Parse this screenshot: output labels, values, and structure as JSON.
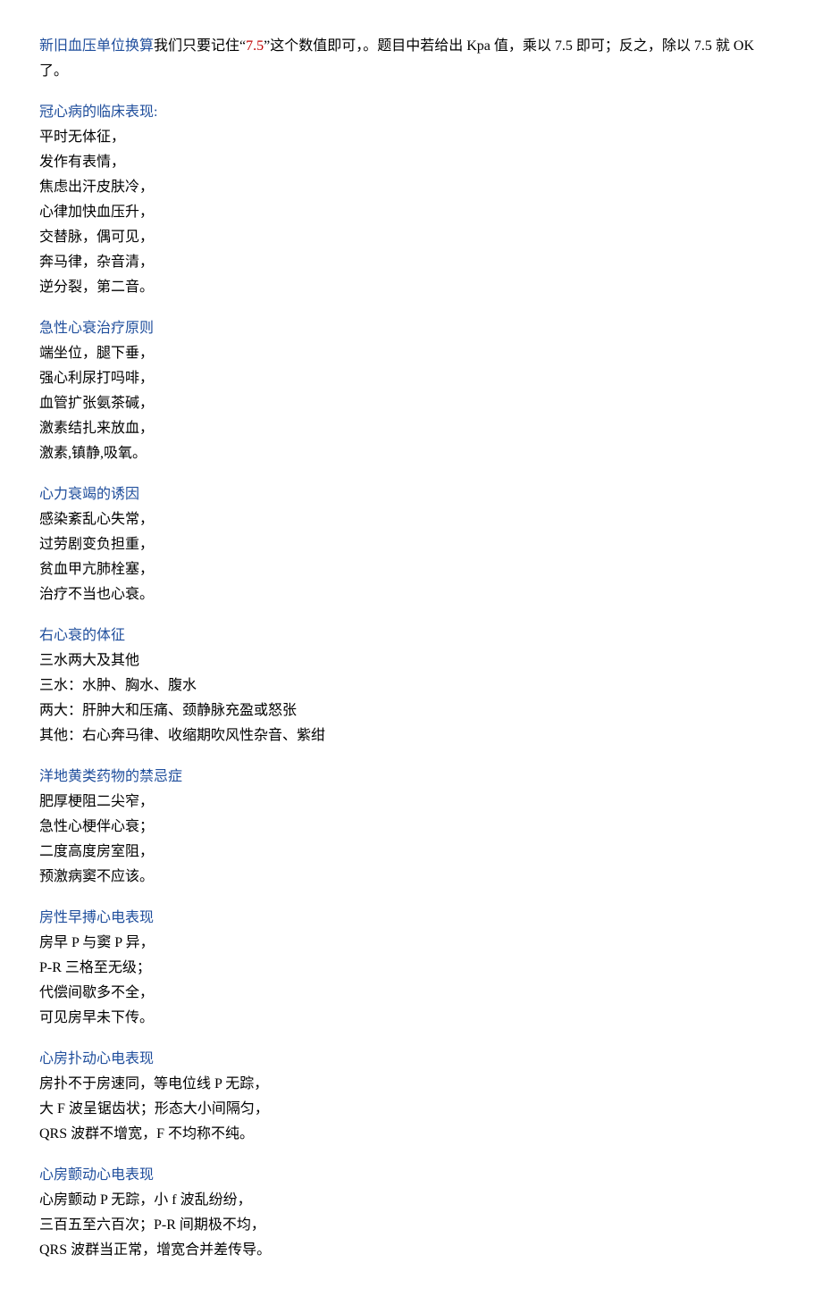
{
  "intro": {
    "heading": "新旧血压单位换算",
    "text_before": "我们只要记住“",
    "highlight": "7.5",
    "text_after": "”这个数值即可，。题目中若给出 Kpa 值，乘以 7.5 即可；反之，除以 7.5 就 OK 了。"
  },
  "sections": [
    {
      "heading": "冠心病的临床表现",
      "heading_suffix": ":",
      "lines": [
        "平时无体征，",
        "发作有表情，",
        "焦虑出汗皮肤冷，",
        "心律加快血压升，",
        "交替脉，偶可见，",
        "奔马律，杂音清，",
        "逆分裂，第二音。"
      ]
    },
    {
      "heading": "急性心衰治疗原则",
      "lines": [
        "端坐位，腿下垂，",
        "强心利尿打吗啡，",
        "血管扩张氨茶碱，",
        "激素结扎来放血，",
        "激素,镇静,吸氧。"
      ]
    },
    {
      "heading": "心力衰竭的诱因",
      "lines": [
        "感染紊乱心失常，",
        "过劳剧变负担重，",
        "贫血甲亢肺栓塞，",
        "治疗不当也心衰。"
      ]
    },
    {
      "heading": "右心衰的体征",
      "lines": [
        "三水两大及其他",
        "三水：水肿、胸水、腹水",
        "两大：肝肿大和压痛、颈静脉充盈或怒张",
        "其他：右心奔马律、收缩期吹风性杂音、紫绀"
      ]
    },
    {
      "heading": "洋地黄类药物的禁忌症",
      "lines": [
        "肥厚梗阻二尖窄，",
        "急性心梗伴心衰；",
        "二度高度房室阻，",
        "预激病窦不应该。"
      ]
    },
    {
      "heading": "房性早搏心电表现",
      "lines": [
        "房早 P 与窦 P 异，",
        "P-R 三格至无级；",
        "代偿间歇多不全，",
        "可见房早未下传。"
      ]
    },
    {
      "heading": "心房扑动心电表现",
      "lines": [
        "房扑不于房速同，等电位线 P 无踪，",
        "大 F 波呈锯齿状；形态大小间隔匀，",
        "QRS 波群不增宽，F 不均称不纯。"
      ]
    },
    {
      "heading": "心房颤动心电表现",
      "lines": [
        "心房颤动 P 无踪，小 f 波乱纷纷，",
        "三百五至六百次；P-R 间期极不均，",
        "QRS 波群当正常，增宽合并差传导。"
      ]
    }
  ]
}
